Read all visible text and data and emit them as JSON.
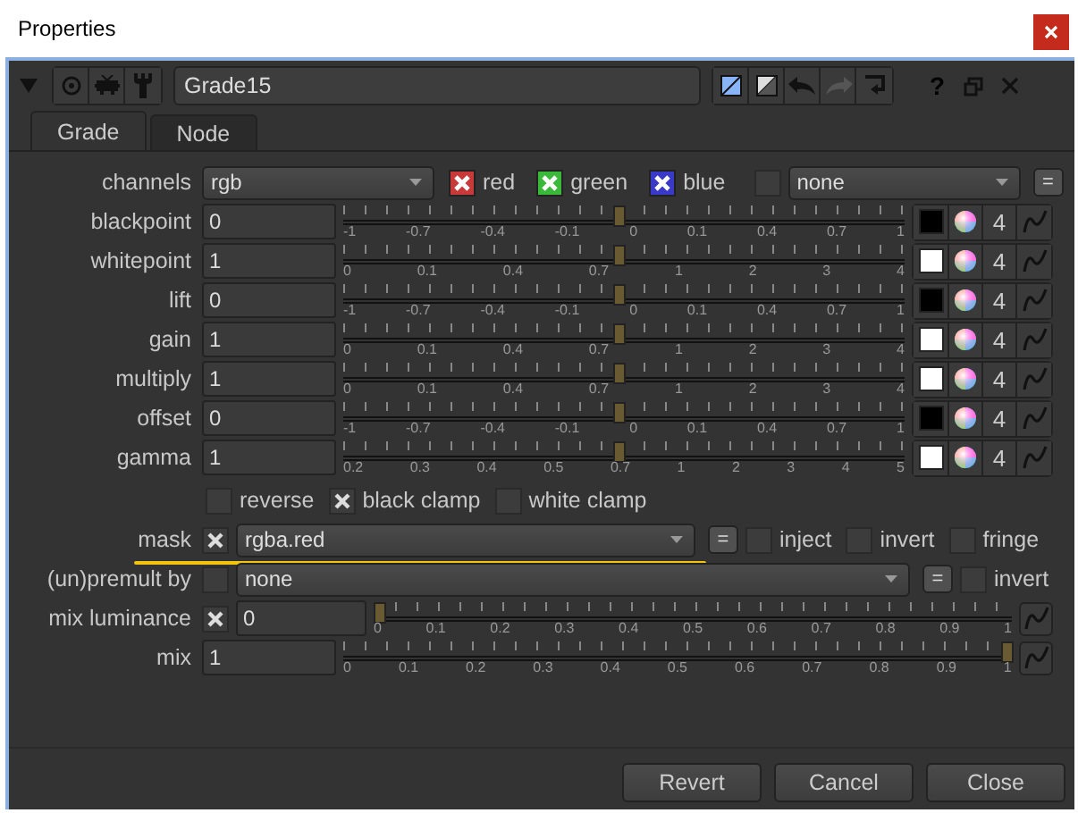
{
  "window": {
    "title": "Properties"
  },
  "node": {
    "name": "Grade15",
    "expanded": true,
    "help": "?"
  },
  "tabs": [
    {
      "label": "Grade",
      "selected": true
    },
    {
      "label": "Node",
      "selected": false
    }
  ],
  "channels": {
    "label": "channels",
    "value": "rgb",
    "toggles": [
      {
        "label": "red",
        "checked": true,
        "color": "#c83a3a"
      },
      {
        "label": "green",
        "checked": true,
        "color": "#3ab83a"
      },
      {
        "label": "blue",
        "checked": true,
        "color": "#3a3ac8"
      }
    ],
    "extra_checked": false,
    "extra_value": "none",
    "link": "="
  },
  "knobs": [
    {
      "label": "blackpoint",
      "value": "0",
      "level": 0.49,
      "scale": [
        "-1",
        "-0.7",
        "-0.4",
        "-0.1",
        "0",
        "0.1",
        "0.4",
        "0.7",
        "1"
      ],
      "color": "#000000",
      "count": "4"
    },
    {
      "label": "whitepoint",
      "value": "1",
      "level": 0.49,
      "scale": [
        "0",
        "0.1",
        "0.4",
        "0.7",
        "1",
        "2",
        "3",
        "4"
      ],
      "color": "#ffffff",
      "count": "4"
    },
    {
      "label": "lift",
      "value": "0",
      "level": 0.49,
      "scale": [
        "-1",
        "-0.7",
        "-0.4",
        "-0.1",
        "0",
        "0.1",
        "0.4",
        "0.7",
        "1"
      ],
      "color": "#000000",
      "count": "4"
    },
    {
      "label": "gain",
      "value": "1",
      "level": 0.49,
      "scale": [
        "0",
        "0.1",
        "0.4",
        "0.7",
        "1",
        "2",
        "3",
        "4"
      ],
      "color": "#ffffff",
      "count": "4"
    },
    {
      "label": "multiply",
      "value": "1",
      "level": 0.49,
      "scale": [
        "0",
        "0.1",
        "0.4",
        "0.7",
        "1",
        "2",
        "3",
        "4"
      ],
      "color": "#ffffff",
      "count": "4"
    },
    {
      "label": "offset",
      "value": "0",
      "level": 0.49,
      "scale": [
        "-1",
        "-0.7",
        "-0.4",
        "-0.1",
        "0",
        "0.1",
        "0.4",
        "0.7",
        "1"
      ],
      "color": "#000000",
      "count": "4"
    },
    {
      "label": "gamma",
      "value": "1",
      "level": 0.49,
      "scale": [
        "0.2",
        "0.3",
        "0.4",
        "0.5",
        "0.7",
        "1",
        "2",
        "3",
        "4",
        "5"
      ],
      "color": "#ffffff",
      "count": "4"
    }
  ],
  "options": [
    {
      "label": "reverse",
      "checked": false
    },
    {
      "label": "black clamp",
      "checked": true
    },
    {
      "label": "white clamp",
      "checked": false
    }
  ],
  "mask": {
    "label": "mask",
    "checked": true,
    "value": "rgba.red",
    "link": "=",
    "highlighted": true,
    "toggles": [
      {
        "label": "inject",
        "checked": false
      },
      {
        "label": "invert",
        "checked": false
      },
      {
        "label": "fringe",
        "checked": false
      }
    ]
  },
  "premult": {
    "label": "(un)premult by",
    "checked": false,
    "value": "none",
    "link": "=",
    "toggles": [
      {
        "label": "invert",
        "checked": false
      }
    ]
  },
  "mix_luminance": {
    "label": "mix luminance",
    "checked": true,
    "value": "0",
    "level": 0,
    "scale": [
      "0",
      "0.1",
      "0.2",
      "0.3",
      "0.4",
      "0.5",
      "0.6",
      "0.7",
      "0.8",
      "0.9",
      "1"
    ]
  },
  "mix": {
    "label": "mix",
    "value": "1",
    "level": 1,
    "scale": [
      "0",
      "0.1",
      "0.2",
      "0.3",
      "0.4",
      "0.5",
      "0.6",
      "0.7",
      "0.8",
      "0.9",
      "1"
    ]
  },
  "buttons": [
    "Revert",
    "Cancel",
    "Close"
  ]
}
